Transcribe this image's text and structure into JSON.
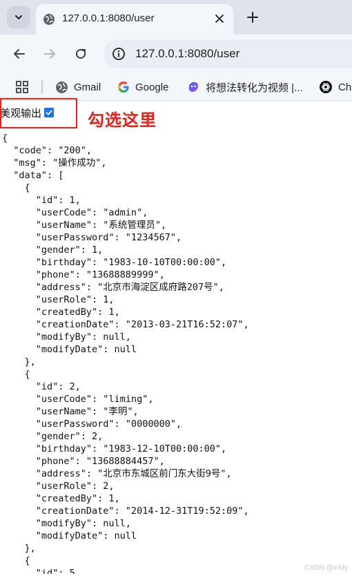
{
  "tab": {
    "title": "127.0.0.1:8080/user"
  },
  "omnibox": {
    "url": "127.0.0.1:8080/user"
  },
  "bookmarks": [
    {
      "label": "Gmail",
      "icon": "globe-icon"
    },
    {
      "label": "Google",
      "icon": "google-icon"
    },
    {
      "label": "将想法转化为视频 |...",
      "icon": "ai-video-icon"
    },
    {
      "label": "Ch",
      "icon": "chatgpt-icon"
    }
  ],
  "viewer": {
    "pretty_label": "美观输出",
    "pretty_checked": true
  },
  "annotation": "勾选这里",
  "json_lines": [
    "{",
    "  \"code\": \"200\",",
    "  \"msg\": \"操作成功\",",
    "  \"data\": [",
    "    {",
    "      \"id\": 1,",
    "      \"userCode\": \"admin\",",
    "      \"userName\": \"系统管理员\",",
    "      \"userPassword\": \"1234567\",",
    "      \"gender\": 1,",
    "      \"birthday\": \"1983-10-10T00:00:00\",",
    "      \"phone\": \"13688889999\",",
    "      \"address\": \"北京市海淀区成府路207号\",",
    "      \"userRole\": 1,",
    "      \"createdBy\": 1,",
    "      \"creationDate\": \"2013-03-21T16:52:07\",",
    "      \"modifyBy\": null,",
    "      \"modifyDate\": null",
    "    },",
    "    {",
    "      \"id\": 2,",
    "      \"userCode\": \"liming\",",
    "      \"userName\": \"李明\",",
    "      \"userPassword\": \"0000000\",",
    "      \"gender\": 2,",
    "      \"birthday\": \"1983-12-10T00:00:00\",",
    "      \"phone\": \"13688884457\",",
    "      \"address\": \"北京市东城区前门东大街9号\",",
    "      \"userRole\": 2,",
    "      \"createdBy\": 1,",
    "      \"creationDate\": \"2014-12-31T19:52:09\",",
    "      \"modifyBy\": null,",
    "      \"modifyDate\": null",
    "    },",
    "    {",
    "      \"id\": 5,"
  ],
  "watermark": "CSDN @xrkfy",
  "colors": {
    "accent": "#1a73e8",
    "annotation": "#e8221b"
  }
}
